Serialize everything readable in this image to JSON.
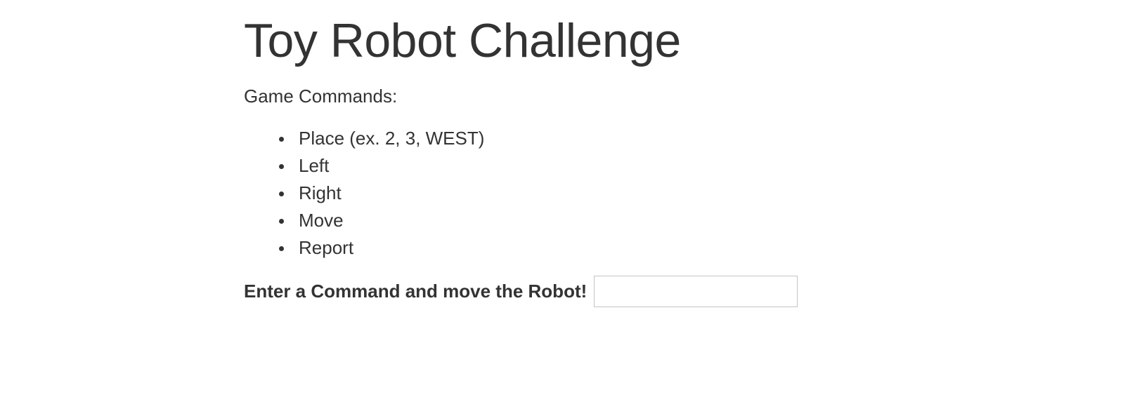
{
  "page": {
    "title": "Toy Robot Challenge",
    "subtitle": "Game Commands:"
  },
  "commands": [
    {
      "label": "Place (ex. 2, 3, WEST)"
    },
    {
      "label": "Left"
    },
    {
      "label": "Right"
    },
    {
      "label": "Move"
    },
    {
      "label": "Report"
    }
  ],
  "command_form": {
    "label": "Enter a Command and move the Robot!",
    "value": "",
    "placeholder": ""
  },
  "colors": {
    "text": "#333333",
    "input_border": "#c4c4c4",
    "background": "#ffffff"
  }
}
